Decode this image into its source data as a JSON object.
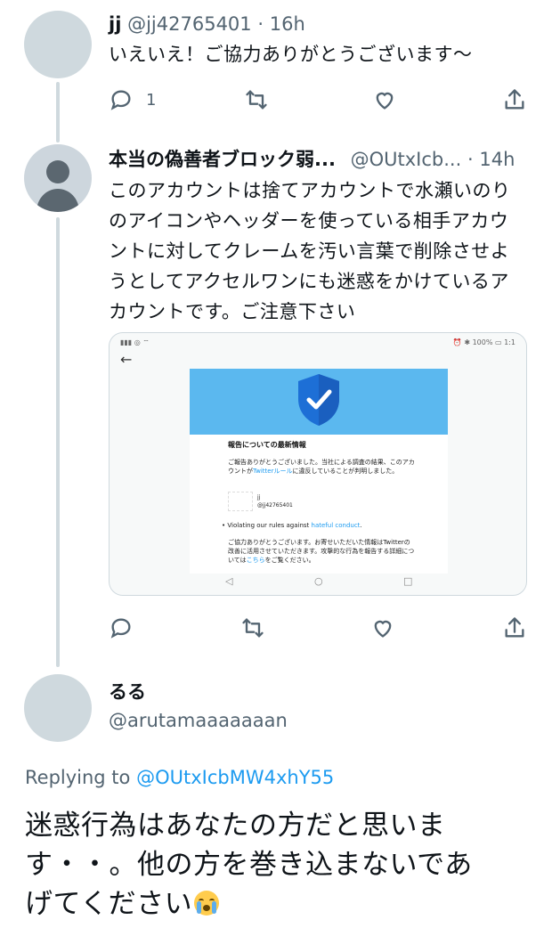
{
  "tweets": [
    {
      "display_name": "jj",
      "handle": "@jj42765401",
      "separator": "·",
      "time": "16h",
      "text": "いえいえ！ご協力ありがとうございます〜",
      "reply_count": "1"
    },
    {
      "display_name": "本当の偽善者ブロック弱...",
      "handle": "@OUtxIcb...",
      "separator": "·",
      "time": "14h",
      "text_lines": [
        "このアカウントは捨てアカウントで水瀬いのり",
        "のアイコンやヘッダーを使っている相手アカウ",
        "ントに対してクレームを汚い言葉で削除させよ",
        "うとしてアクセルワンにも迷惑をかけているア",
        "カウントです。ご注意下さい"
      ]
    }
  ],
  "embedded_screenshot": {
    "status_left": "",
    "status_right": "100%",
    "title": "報告についての最新情報",
    "body_pre": "ご報告ありがとうございました。当社による調査の結果、このアカウントが",
    "body_link": "Twitterルール",
    "body_post": "に違反していることが判明しました。",
    "user_name": "jj",
    "user_handle": "@jj42765401",
    "bullet_pre": "Violating our rules against ",
    "bullet_link": "hateful conduct",
    "bullet_post": ".",
    "body2_pre": "ご協力ありがとうございます。お寄せいただいた情報はTwitterの改善に活用させていただきます。攻撃的な行為を報告する詳細については",
    "body2_link": "こちら",
    "body2_post": "をご覧ください。"
  },
  "main_tweet": {
    "display_name": "るる",
    "handle": "@arutamaaaaaaan",
    "replying_prefix": "Replying to ",
    "replying_mention": "@OUtxIcbMW4xhY55",
    "text_lines": [
      "迷惑行為はあなたの方だと思いま",
      "す・・。他の方を巻き込まないであ",
      "げてください"
    ],
    "emoji": "loudly-crying-face"
  },
  "colors": {
    "accent": "#1d9bf0",
    "muted": "#536471",
    "text": "#0f1419",
    "avatar_placeholder": "#cfd9de",
    "banner": "#5bb8ef"
  }
}
